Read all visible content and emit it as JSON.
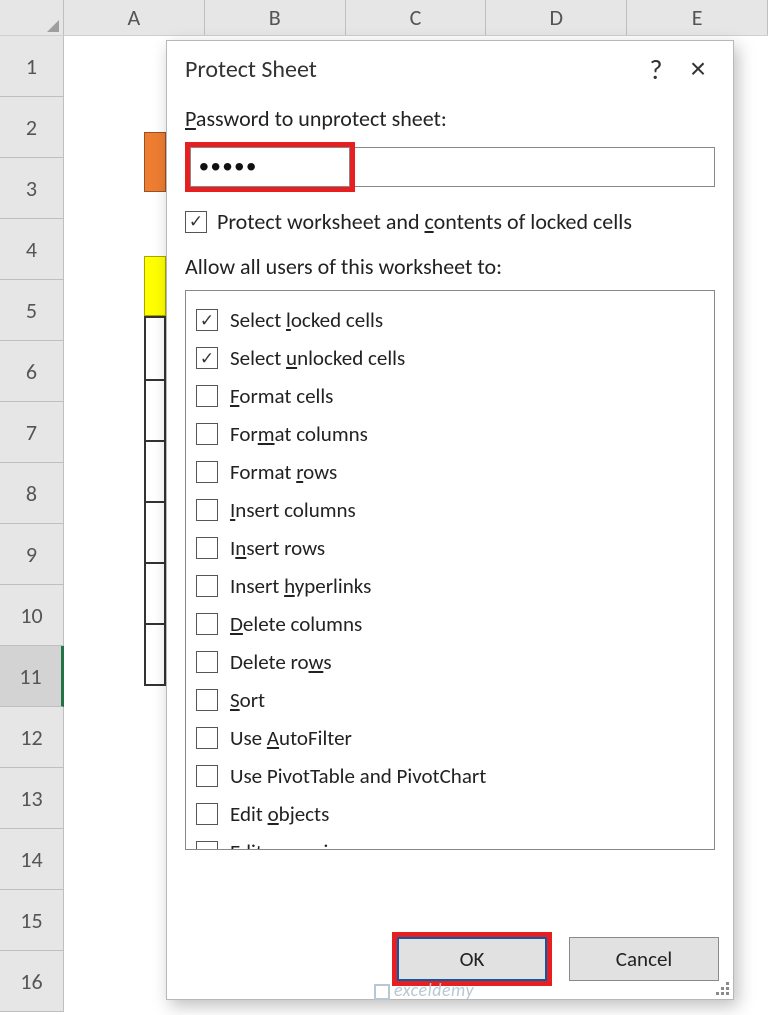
{
  "sheet": {
    "columns": [
      "A",
      "B",
      "C",
      "D",
      "E"
    ],
    "rows": [
      "1",
      "2",
      "3",
      "4",
      "5",
      "6",
      "7",
      "8",
      "9",
      "10",
      "11",
      "12",
      "13",
      "14",
      "15",
      "16"
    ],
    "selected_row": "11"
  },
  "dialog": {
    "title": "Protect Sheet",
    "help_symbol": "?",
    "close_symbol": "×",
    "password_label_pre": "P",
    "password_label_rest": "assword to unprotect sheet:",
    "password_value": "•••••",
    "protect_checked": true,
    "protect_label_pre": "Protect worksheet and ",
    "protect_label_u": "c",
    "protect_label_post": "ontents of locked cells",
    "allow_label": "Allow all users of this worksheet to:",
    "permissions": [
      {
        "checked": true,
        "pre": "Select ",
        "u": "l",
        "post": "ocked cells"
      },
      {
        "checked": true,
        "pre": "Select ",
        "u": "u",
        "post": "nlocked cells"
      },
      {
        "checked": false,
        "pre": "",
        "u": "F",
        "post": "ormat cells"
      },
      {
        "checked": false,
        "pre": "For",
        "u": "m",
        "post": "at columns"
      },
      {
        "checked": false,
        "pre": "Format ",
        "u": "r",
        "post": "ows"
      },
      {
        "checked": false,
        "pre": "",
        "u": "I",
        "post": "nsert columns"
      },
      {
        "checked": false,
        "pre": "I",
        "u": "n",
        "post": "sert rows"
      },
      {
        "checked": false,
        "pre": "Insert ",
        "u": "h",
        "post": "yperlinks"
      },
      {
        "checked": false,
        "pre": "",
        "u": "D",
        "post": "elete columns"
      },
      {
        "checked": false,
        "pre": "Delete ro",
        "u": "w",
        "post": "s"
      },
      {
        "checked": false,
        "pre": "",
        "u": "S",
        "post": "ort"
      },
      {
        "checked": false,
        "pre": "Use ",
        "u": "A",
        "post": "utoFilter"
      },
      {
        "checked": false,
        "pre": "Use PivotTable and PivotChart",
        "u": "",
        "post": ""
      },
      {
        "checked": false,
        "pre": "Edit ",
        "u": "o",
        "post": "bjects"
      },
      {
        "checked": false,
        "pre": "",
        "u": "E",
        "post": "dit scenarios"
      }
    ],
    "ok_label": "OK",
    "cancel_label": "Cancel"
  },
  "watermark": "exceldemy"
}
